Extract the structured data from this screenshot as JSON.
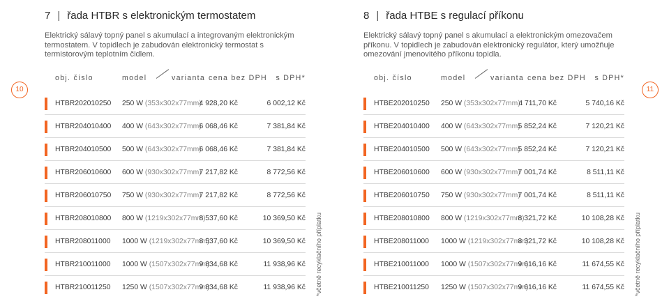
{
  "left": {
    "page_number": "10",
    "title_number": "7",
    "title": "řada HTBR s elektronickým termostatem",
    "description": "Elektrický sálavý topný panel s akumulací a integrovaným elektronickým termostatem. V topidlech je zabudován elektronický termostat s termistorovým teplotním čidlem.",
    "headers": {
      "code": "obj. číslo",
      "model": "model",
      "variant": "varianta",
      "price": "cena bez DPH",
      "vat": "s DPH*"
    },
    "rows": [
      {
        "code": "HTBR202010250",
        "power": "250 W",
        "dims": "(353x302x77mm)",
        "price": "4 928,20 Kč",
        "vat": "6 002,12 Kč"
      },
      {
        "code": "HTBR204010400",
        "power": "400 W",
        "dims": "(643x302x77mm)",
        "price": "6 068,46 Kč",
        "vat": "7 381,84 Kč"
      },
      {
        "code": "HTBR204010500",
        "power": "500 W",
        "dims": "(643x302x77mm)",
        "price": "6 068,46 Kč",
        "vat": "7 381,84 Kč"
      },
      {
        "code": "HTBR206010600",
        "power": "600 W",
        "dims": "(930x302x77mm)",
        "price": "7 217,82 Kč",
        "vat": "8 772,56 Kč"
      },
      {
        "code": "HTBR206010750",
        "power": "750 W",
        "dims": "(930x302x77mm)",
        "price": "7 217,82 Kč",
        "vat": "8 772,56 Kč"
      },
      {
        "code": "HTBR208010800",
        "power": "800 W",
        "dims": "(1219x302x77mm)",
        "price": "8 537,60 Kč",
        "vat": "10 369,50 Kč"
      },
      {
        "code": "HTBR208011000",
        "power": "1000 W",
        "dims": "(1219x302x77mm)",
        "price": "8 537,60 Kč",
        "vat": "10 369,50 Kč"
      },
      {
        "code": "HTBR210011000",
        "power": "1000 W",
        "dims": "(1507x302x77mm)",
        "price": "9 834,68 Kč",
        "vat": "11 938,96 Kč"
      },
      {
        "code": "HTBR210011250",
        "power": "1250 W",
        "dims": "(1507x302x77mm)",
        "price": "9 834,68 Kč",
        "vat": "11 938,96 Kč"
      }
    ],
    "side_note": "*včetně recyklačního příplatku"
  },
  "right": {
    "page_number": "11",
    "title_number": "8",
    "title": "řada HTBE s regulací příkonu",
    "description": "Elektrický sálavý topný panel s akumulací a elektronickým omezovačem příkonu. V topidlech je zabudován elektronický regulátor, který umožňuje omezování jmenovitého příkonu topidla.",
    "headers": {
      "code": "obj. číslo",
      "model": "model",
      "variant": "varianta",
      "price": "cena bez DPH",
      "vat": "s DPH*"
    },
    "rows": [
      {
        "code": "HTBE202010250",
        "power": "250 W",
        "dims": "(353x302x77mm)",
        "price": "4 711,70 Kč",
        "vat": "5 740,16 Kč"
      },
      {
        "code": "HTBE204010400",
        "power": "400 W",
        "dims": "(643x302x77mm)",
        "price": "5 852,24 Kč",
        "vat": "7 120,21 Kč"
      },
      {
        "code": "HTBE204010500",
        "power": "500 W",
        "dims": "(643x302x77mm)",
        "price": "5 852,24 Kč",
        "vat": "7 120,21 Kč"
      },
      {
        "code": "HTBE206010600",
        "power": "600 W",
        "dims": "(930x302x77mm)",
        "price": "7 001,74 Kč",
        "vat": "8 511,11 Kč"
      },
      {
        "code": "HTBE206010750",
        "power": "750 W",
        "dims": "(930x302x77mm)",
        "price": "7 001,74 Kč",
        "vat": "8 511,11 Kč"
      },
      {
        "code": "HTBE208010800",
        "power": "800 W",
        "dims": "(1219x302x77mm)",
        "price": "8 321,72 Kč",
        "vat": "10 108,28 Kč"
      },
      {
        "code": "HTBE208011000",
        "power": "1000 W",
        "dims": "(1219x302x77mm)",
        "price": "8 321,72 Kč",
        "vat": "10 108,28 Kč"
      },
      {
        "code": "HTBE210011000",
        "power": "1000 W",
        "dims": "(1507x302x77mm)",
        "price": "9 616,16 Kč",
        "vat": "11 674,55 Kč"
      },
      {
        "code": "HTBE210011250",
        "power": "1250 W",
        "dims": "(1507x302x77mm)",
        "price": "9 616,16 Kč",
        "vat": "11 674,55 Kč"
      }
    ],
    "side_note": "*včetně recyklačního příplatku"
  },
  "colors": {
    "accent": "#f26522",
    "divider": "#d9d9d9"
  }
}
